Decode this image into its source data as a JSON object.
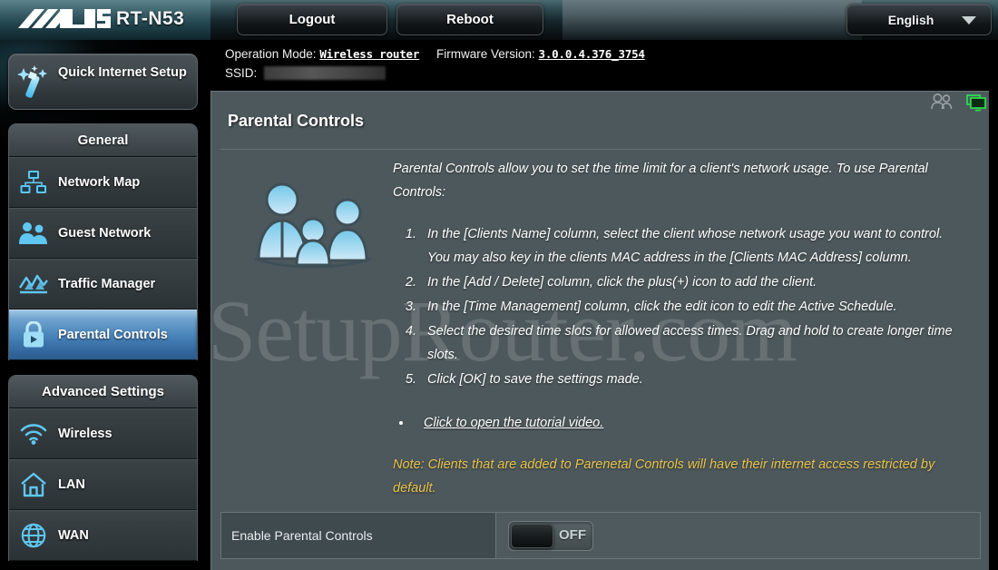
{
  "header": {
    "brand_logo": "asus-logo",
    "model": "RT-N53",
    "logout_label": "Logout",
    "reboot_label": "Reboot",
    "language": "English",
    "caret_icon": "chevron-down-icon"
  },
  "info": {
    "operation_mode_label": "Operation Mode:",
    "operation_mode_value": "Wireless router",
    "firmware_label": "Firmware Version:",
    "firmware_value": "3.0.0.4.376_3754",
    "ssid_label": "SSID:",
    "ssid_value": "",
    "clients_icon": "clients-icon",
    "network_icon": "network-monitor-icon"
  },
  "sidebar": {
    "quick_setup": {
      "label": "Quick Internet Setup",
      "icon": "magic-wand-icon"
    },
    "sections": [
      {
        "title": "General",
        "items": [
          {
            "label": "Network Map",
            "icon": "network-map-icon",
            "active": false
          },
          {
            "label": "Guest Network",
            "icon": "guest-network-icon",
            "active": false
          },
          {
            "label": "Traffic Manager",
            "icon": "traffic-manager-icon",
            "active": false
          },
          {
            "label": "Parental Controls",
            "icon": "parental-lock-icon",
            "active": true
          }
        ]
      },
      {
        "title": "Advanced Settings",
        "items": [
          {
            "label": "Wireless",
            "icon": "wifi-icon",
            "active": false
          },
          {
            "label": "LAN",
            "icon": "home-icon",
            "active": false
          },
          {
            "label": "WAN",
            "icon": "globe-icon",
            "active": false
          }
        ]
      }
    ]
  },
  "main": {
    "page_title": "Parental Controls",
    "watermark": "SetupRouter.com",
    "family_icon": "family-illustration-icon",
    "intro": "Parental Controls allow you to set the time limit for a client's network usage. To use Parental Controls:",
    "steps": [
      "In the [Clients Name] column, select the client whose network usage you want to control. You may also key in the clients MAC address in the [Clients MAC Address] column.",
      "In the [Add / Delete] column, click the plus(+) icon to add the client.",
      "In the [Time Management] column, click the edit icon to edit the Active Schedule.",
      "Select the desired time slots for allowed access times. Drag and hold to create longer time slots.",
      "Click [OK] to save the settings made."
    ],
    "bullets": [
      "Click to open the tutorial video."
    ],
    "note": "Note: Clients that are added to Parenetal Controls will have their internet access restricted by default.",
    "setting_row": {
      "label": "Enable Parental Controls",
      "toggle_state": "OFF"
    }
  },
  "colors": {
    "accent_blue": "#4a85bb",
    "icon_cyan": "#5fc7f2",
    "note_yellow": "#e8c34a",
    "panel_bg": "#4d585c",
    "sidebar_bg": "#2b3235"
  }
}
